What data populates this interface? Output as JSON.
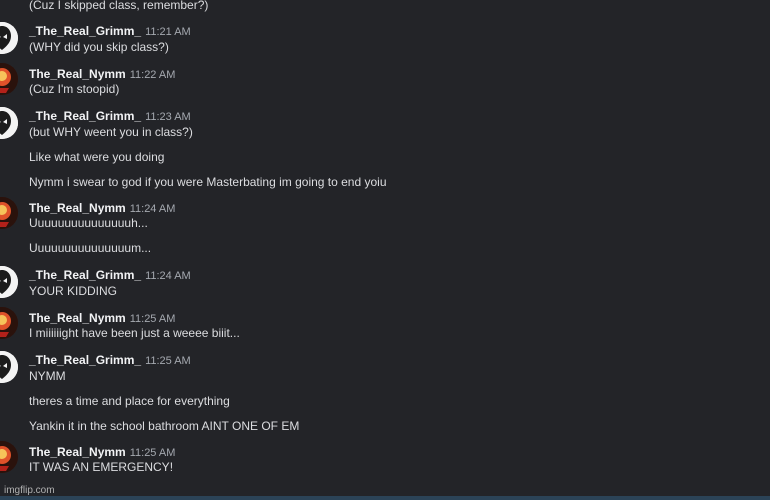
{
  "messages": {
    "top_continuation": "(Cuz I skipped class, remember?)",
    "g1": {
      "user": "_The_Real_Grimm_",
      "time": "11:21 AM",
      "lines": [
        "(WHY did you skip class?)"
      ]
    },
    "n1": {
      "user": "The_Real_Nymm",
      "time": "11:22 AM",
      "lines": [
        "(Cuz I'm stoopid)"
      ]
    },
    "g2": {
      "user": "_The_Real_Grimm_",
      "time": "11:23 AM",
      "lines": [
        "(but WHY weent you in class?)",
        "Like what were you doing",
        "Nymm i swear to god if you were Masterbating im going to end yoiu"
      ]
    },
    "n2": {
      "user": "The_Real_Nymm",
      "time": "11:24 AM",
      "lines": [
        "Uuuuuuuuuuuuuuuh...",
        "Uuuuuuuuuuuuuuum..."
      ]
    },
    "g3": {
      "user": "_The_Real_Grimm_",
      "time": "11:24 AM",
      "lines": [
        "YOUR KIDDING"
      ]
    },
    "n3": {
      "user": "The_Real_Nymm",
      "time": "11:25 AM",
      "lines": [
        "I miiiiiight have been just a weeee biiit..."
      ]
    },
    "g4": {
      "user": "_The_Real_Grimm_",
      "time": "11:25 AM",
      "lines": [
        "NYMM",
        "theres a time and place for everything",
        "Yankin it in the school bathroom AINT ONE OF EM"
      ]
    },
    "n4": {
      "user": "The_Real_Nymm",
      "time": "11:25 AM",
      "lines": [
        "IT WAS AN EMERGENCY!"
      ]
    }
  },
  "watermark": "imgflip.com",
  "colors": {
    "background": "#232428",
    "username": "#f2f3f5",
    "message_text": "#dcdde0",
    "timestamp": "#a5a9b0"
  },
  "icons": {
    "grimm_avatar": "grimm-avatar-icon",
    "nymm_avatar": "nymm-avatar-icon"
  }
}
